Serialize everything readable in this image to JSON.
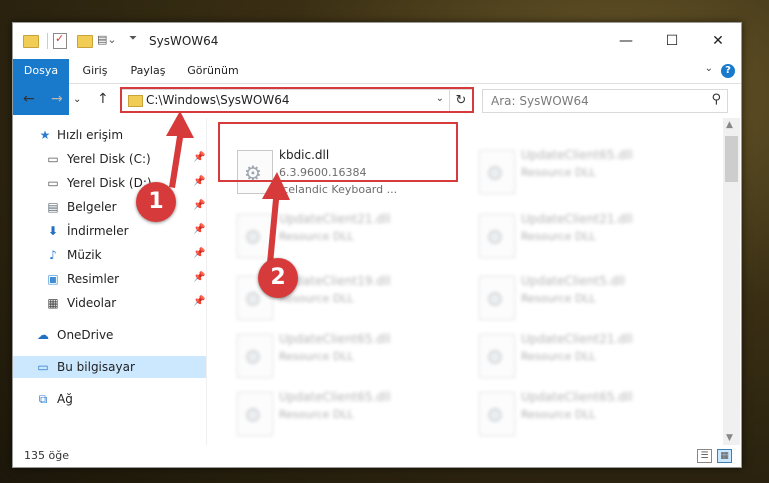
{
  "window": {
    "title": "SysWOW64",
    "minimize_glyph": "—",
    "maximize_glyph": "☐",
    "close_glyph": "✕"
  },
  "ribbon": {
    "tabs": [
      "Dosya",
      "Giriş",
      "Paylaş",
      "Görünüm"
    ],
    "help_glyph": "?",
    "collapse_glyph": "⌄"
  },
  "address": {
    "path": "C:\\Windows\\SysWOW64",
    "back_glyph": "←",
    "forward_glyph": "→",
    "recent_glyph": "⌄",
    "up_glyph": "↑",
    "dropdown_glyph": "⌄",
    "refresh_glyph": "↻"
  },
  "search": {
    "placeholder": "Ara: SysWOW64",
    "icon": "search-icon",
    "glyph": "⚲"
  },
  "nav": {
    "quick_access": "Hızlı erişim",
    "items": [
      {
        "label": "Yerel Disk (C:)",
        "icon": "drive-icon",
        "pinned": true
      },
      {
        "label": "Yerel Disk (D:)",
        "icon": "drive-icon",
        "pinned": true
      },
      {
        "label": "Belgeler",
        "icon": "documents-icon",
        "pinned": true
      },
      {
        "label": "İndirmeler",
        "icon": "downloads-icon",
        "pinned": true
      },
      {
        "label": "Müzik",
        "icon": "music-icon",
        "pinned": true
      },
      {
        "label": "Resimler",
        "icon": "pictures-icon",
        "pinned": true
      },
      {
        "label": "Videolar",
        "icon": "videos-icon",
        "pinned": true
      }
    ],
    "onedrive": "OneDrive",
    "this_pc": "Bu bilgisayar",
    "network": "Ağ",
    "pin_glyph": "📌"
  },
  "files": [
    {
      "name": "kbdic.dll",
      "version": "6.3.9600.16384",
      "description": "Icelandic Keyboard ..."
    },
    {
      "name": "UpdateClient65.dll",
      "description": "Resource DLL"
    },
    {
      "name": "UpdateClient21.dll",
      "description": "Resource DLL"
    },
    {
      "name": "UpdateClient21.dll",
      "description": "Resource DLL"
    },
    {
      "name": "UpdateClient19.dll",
      "description": "Resource DLL"
    },
    {
      "name": "UpdateClient5.dll",
      "description": "Resource DLL"
    },
    {
      "name": "UpdateClient65.dll",
      "description": "Resource DLL"
    },
    {
      "name": "UpdateClient21.dll",
      "description": "Resource DLL"
    },
    {
      "name": "UpdateClient65.dll",
      "description": "Resource DLL"
    },
    {
      "name": "UpdateClient65.dll",
      "description": "Resource DLL"
    }
  ],
  "scrollbar": {
    "up_glyph": "▲",
    "down_glyph": "▼"
  },
  "status": {
    "item_count": "135 öğe",
    "details_glyph": "☰",
    "tiles_glyph": "▦"
  },
  "annotations": {
    "step1": "1",
    "step2": "2",
    "color": "#d63a3a"
  }
}
